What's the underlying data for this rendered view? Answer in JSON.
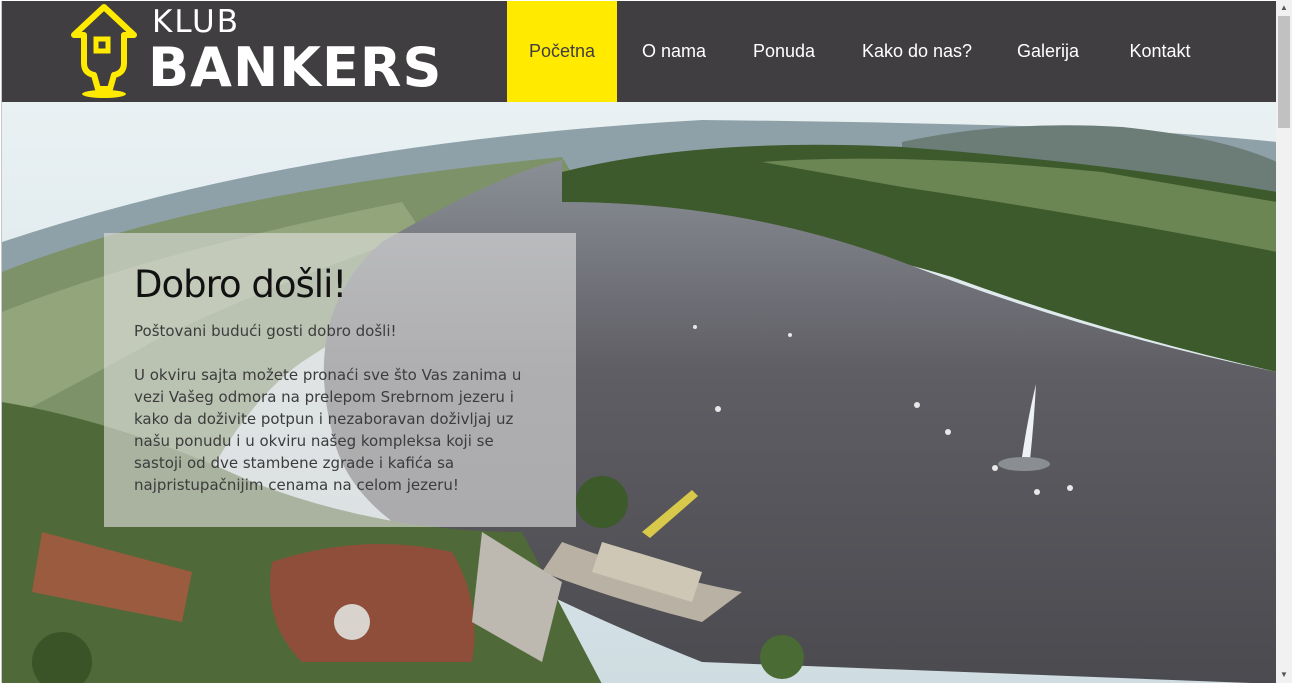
{
  "brand": {
    "small": "KLUB",
    "big": "BANKERS",
    "accent": "#ffea00",
    "header_bg": "#403e40",
    "mark_icon": "house-on-pin-icon"
  },
  "nav": {
    "items": [
      {
        "label": "Početna",
        "active": true
      },
      {
        "label": "O nama",
        "active": false
      },
      {
        "label": "Ponuda",
        "active": false
      },
      {
        "label": "Kako do nas?",
        "active": false
      },
      {
        "label": "Galerija",
        "active": false
      },
      {
        "label": "Kontakt",
        "active": false
      }
    ]
  },
  "welcome": {
    "title": "Dobro došli!",
    "greeting": "Poštovani budući gosti dobro došli!",
    "body": "U okviru sajta možete pronaći sve što Vas zanima u vezi Vašeg odmora na prelepom Srebrnom jezeru i kako da doživite potpun i nezaboravan doživljaj uz našu ponudu i u okviru našeg kompleksa koji se sastoji od dve stambene zgrade i kafića sa najpristupačnijim cenama na celom jezeru!"
  },
  "scrollbar": {
    "up_icon": "scroll-up-arrow-icon",
    "down_icon": "scroll-down-arrow-icon"
  }
}
